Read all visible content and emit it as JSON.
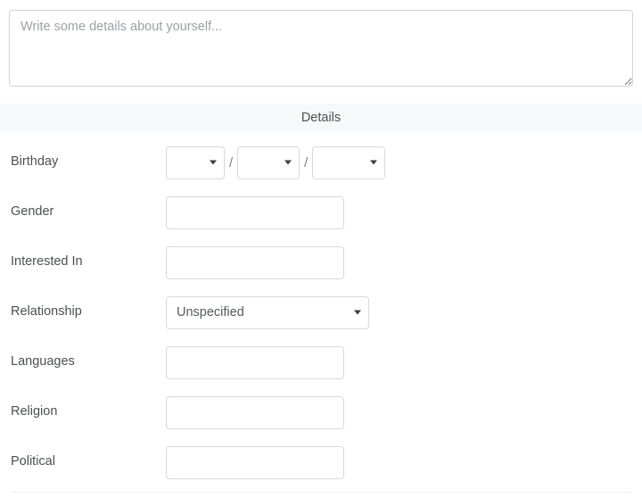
{
  "bio": {
    "placeholder": "Write some details about yourself...",
    "value": ""
  },
  "section": {
    "title": "Details"
  },
  "fields": {
    "birthday": {
      "label": "Birthday",
      "separator": "/",
      "month": {
        "value": "",
        "icon": "chevron-down-icon"
      },
      "day": {
        "value": "",
        "icon": "chevron-down-icon"
      },
      "year": {
        "value": "",
        "icon": "chevron-down-icon"
      }
    },
    "gender": {
      "label": "Gender",
      "value": "",
      "placeholder": ""
    },
    "interested_in": {
      "label": "Interested In",
      "value": "",
      "placeholder": ""
    },
    "relationship": {
      "label": "Relationship",
      "value": "Unspecified",
      "icon": "chevron-down-icon"
    },
    "languages": {
      "label": "Languages",
      "value": "",
      "placeholder": ""
    },
    "religion": {
      "label": "Religion",
      "value": "",
      "placeholder": ""
    },
    "political": {
      "label": "Political",
      "value": "",
      "placeholder": ""
    }
  },
  "colors": {
    "page_background": "#ffffff",
    "section_header_background": "#f7f8f9",
    "input_border": "#d6dade",
    "textarea_border": "#ced4da",
    "label_text": "#4c4f52",
    "placeholder_text": "#9ba1a6",
    "divider": "#eceef0"
  }
}
